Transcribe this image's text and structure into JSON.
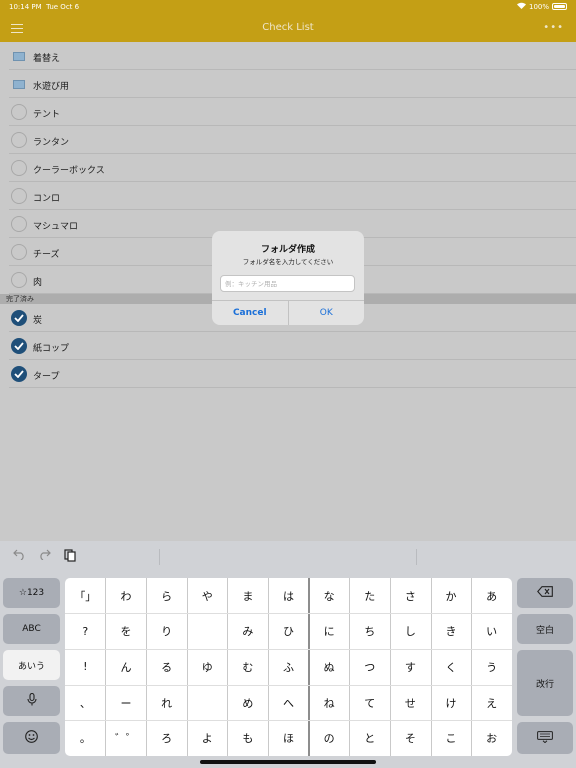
{
  "status_bar": {
    "time": "10:14 PM",
    "date": "Tue Oct 6",
    "battery": "100%"
  },
  "nav": {
    "title": "Check List",
    "more": "•••"
  },
  "folders": [
    "着替え",
    "水遊び用"
  ],
  "unchecked_items": [
    "テント",
    "ランタン",
    "クーラーボックス",
    "コンロ",
    "マシュマロ",
    "チーズ",
    "肉"
  ],
  "completed_section": "完了済み",
  "checked_items": [
    "炭",
    "紙コップ",
    "タープ"
  ],
  "dialog": {
    "title": "フォルダ作成",
    "message": "フォルダ名を入力してください",
    "placeholder": "例：キッチン用品",
    "value": "",
    "cancel": "Cancel",
    "ok": "OK"
  },
  "keyboard": {
    "left_keys": [
      "☆123",
      "ABC",
      "あいう"
    ],
    "right_keys": {
      "space": "空白",
      "enter": "改行"
    },
    "grid": [
      [
        "「」",
        "わ",
        "ら",
        "や",
        "ま",
        "は",
        "な",
        "た",
        "さ",
        "か",
        "あ"
      ],
      [
        "?",
        "を",
        "り",
        "",
        "み",
        "ひ",
        "に",
        "ち",
        "し",
        "き",
        "い"
      ],
      [
        "!",
        "ん",
        "る",
        "ゆ",
        "む",
        "ふ",
        "ぬ",
        "つ",
        "す",
        "く",
        "う"
      ],
      [
        "、",
        "ー",
        "れ",
        "",
        "め",
        "へ",
        "ね",
        "て",
        "せ",
        "け",
        "え"
      ],
      [
        "。",
        "゛゜",
        "ろ",
        "よ",
        "も",
        "ほ",
        "の",
        "と",
        "そ",
        "こ",
        "お"
      ]
    ]
  },
  "colors": {
    "accent": "#c49f15",
    "link": "#1a6fd8",
    "check": "#1f4f79"
  }
}
